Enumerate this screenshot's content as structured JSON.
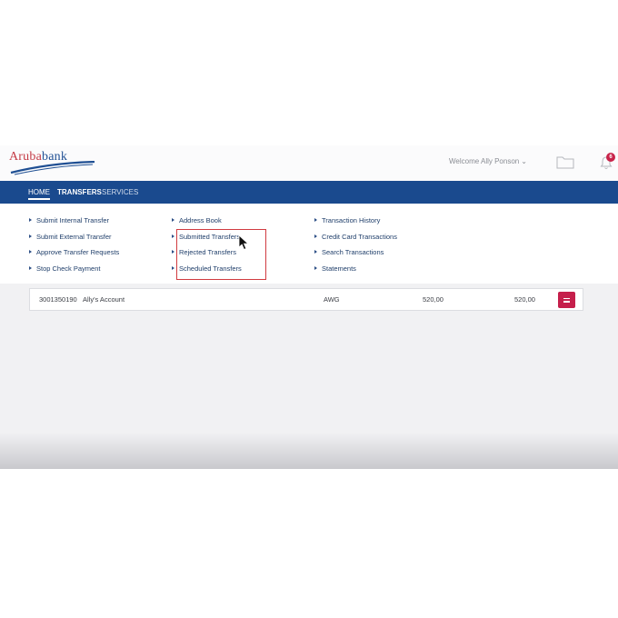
{
  "brand": {
    "logo_part1": "Aruba",
    "logo_part2": "bank",
    "primary_color": "#1a4a8e",
    "logo_red": "#c43a45",
    "accent_color": "#c51f4b"
  },
  "header": {
    "welcome_text": "Welcome Ally Ponson",
    "welcome_caret": "⌄",
    "notification_count": "6",
    "icons": [
      "folder-icon",
      "bell-icon"
    ]
  },
  "nav": {
    "home": "HOME",
    "transfers": "TRANSFERS",
    "services": "SERVICES",
    "active": "TRANSFERS"
  },
  "menu": {
    "col1": [
      {
        "label": "Submit Internal Transfer"
      },
      {
        "label": "Submit External Transfer"
      },
      {
        "label": "Approve Transfer Requests"
      },
      {
        "label": "Stop Check Payment"
      }
    ],
    "col2": [
      {
        "label": "Address Book"
      },
      {
        "label": "Submitted Transfers"
      },
      {
        "label": "Rejected Transfers"
      },
      {
        "label": "Scheduled Transfers"
      }
    ],
    "col3": [
      {
        "label": "Transaction History"
      },
      {
        "label": "Credit Card Transactions"
      },
      {
        "label": "Search Transactions"
      },
      {
        "label": "Statements"
      }
    ]
  },
  "account": {
    "number": "3001350190",
    "name": "Ally's Account",
    "currency": "AWG",
    "balance": "520,00",
    "available": "520,00"
  }
}
